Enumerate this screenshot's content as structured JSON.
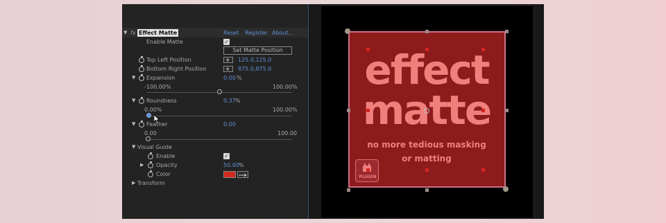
{
  "effect": {
    "fx_label": "fx",
    "name": "Effect Matte",
    "reset": "Reset",
    "register": "Register",
    "about": "About..."
  },
  "enable_matte": {
    "label": "Enable Matte",
    "checked": true
  },
  "set_matte_position": "Set Matte Position",
  "top_left": {
    "label": "Top Left Position",
    "value": "125.0,125.0"
  },
  "bottom_right": {
    "label": "Bottom Right Position",
    "value": "875.0,875.0"
  },
  "expansion": {
    "label": "Expansion",
    "value": "0.00",
    "unit": "%",
    "min": "-100.00%",
    "max": "100.00%",
    "fraction": 0.5
  },
  "roundness": {
    "label": "Roundness",
    "value": "0.37",
    "unit": "%",
    "min": "0.00%",
    "max": "100.00%",
    "fraction": 0.0037
  },
  "feather": {
    "label": "Feather",
    "value": "0.00",
    "min": "0.00",
    "max": "100.00",
    "fraction": 0.0
  },
  "visual_guide": {
    "label": "Visual Guide",
    "enable": {
      "label": "Enable",
      "checked": true
    },
    "opacity": {
      "label": "Opacity",
      "value": "50.00",
      "unit": "%"
    },
    "color": {
      "label": "Color",
      "swatch": "#d42a1f"
    }
  },
  "transform": {
    "label": "Transform"
  },
  "preview": {
    "line1": "effect",
    "line2": "matte",
    "tagline1": "no more tedious masking",
    "tagline2": "or matting",
    "badge": "PLUGIN",
    "matte_color": "#8d1b1c",
    "text_color": "#ef7f7d"
  }
}
